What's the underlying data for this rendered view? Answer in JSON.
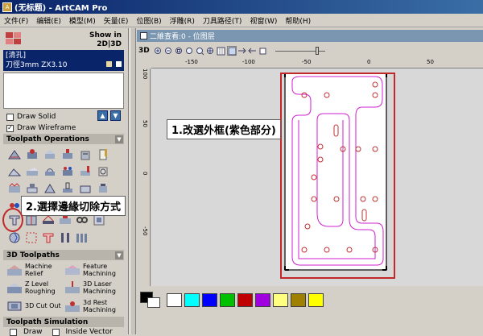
{
  "window": {
    "title": "(无标题) - ArtCAM Pro"
  },
  "menu": [
    "文件(F)",
    "编辑(E)",
    "模型(M)",
    "矢量(E)",
    "位图(B)",
    "浮雕(R)",
    "刀具路径(T)",
    "视窗(W)",
    "帮助(H)"
  ],
  "left_panel": {
    "show_in_label": "Show in",
    "view_2d3d": "2D|3D",
    "toolpath_name": "[清孔]",
    "tool_desc": "刀徑3mm ZX3.10",
    "draw_solid": {
      "label": "Draw Solid",
      "checked": false
    },
    "draw_wireframe": {
      "label": "Draw Wireframe",
      "checked": true
    },
    "toolpath_operations_header": "Toolpath Operations",
    "three_d_toolpaths_header": "3D Toolpaths",
    "three_d_items": [
      {
        "label": "Machine Relief",
        "icon": "machine-relief-icon"
      },
      {
        "label": "Feature Machining",
        "icon": "feature-machining-icon"
      },
      {
        "label": "Z Level Roughing",
        "icon": "z-level-roughing-icon"
      },
      {
        "label": "3D Laser Machining",
        "icon": "laser-machining-icon"
      },
      {
        "label": "3D Cut Out",
        "icon": "cut-out-icon"
      },
      {
        "label": "3d Rest Machining",
        "icon": "rest-machining-icon"
      }
    ],
    "toolpath_simulation_header": "Toolpath Simulation",
    "draw_label": "Draw",
    "inside_vector_label": "Inside Vector"
  },
  "view": {
    "title": "二維查看:0 - 位图层",
    "toolbar_3d": "3D",
    "h_ruler": [
      "-150",
      "-100",
      "-50",
      "0",
      "50"
    ],
    "v_ruler": [
      "100",
      "50",
      "0",
      "-50"
    ]
  },
  "callouts": {
    "step1": "1.改選外框(紫色部分)",
    "step2": "2.選擇邊緣切除方式"
  },
  "palette": {
    "colors": [
      "#ffffff",
      "#00ffff",
      "#0000ff",
      "#00c000",
      "#c00000",
      "#a000e0",
      "#ffff80",
      "#a08000",
      "#ffff00"
    ],
    "foreground": "#000000",
    "background": "#ffffff"
  },
  "colors": {
    "accent_red": "#c0282a",
    "vector_magenta": "#d020d0",
    "title_blue": "#0a246a"
  }
}
